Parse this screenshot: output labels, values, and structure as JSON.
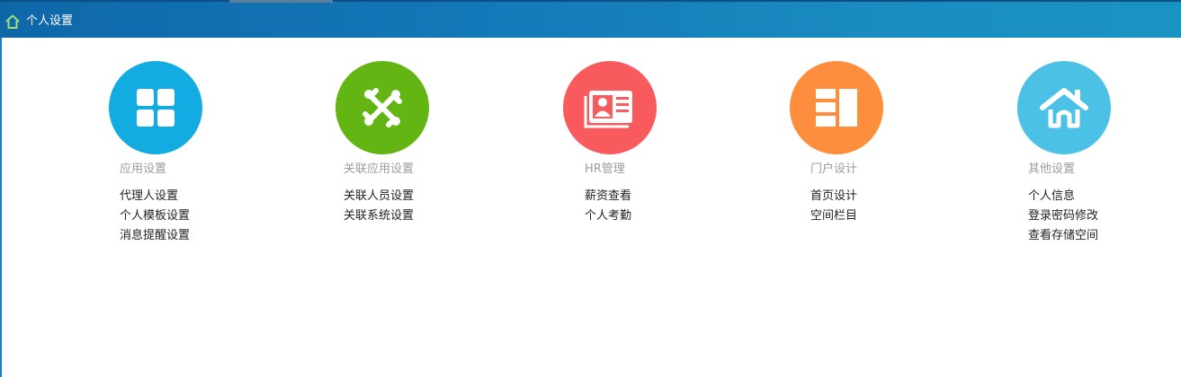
{
  "header": {
    "title": "个人设置",
    "home_icon": "home-icon",
    "bar_color": "#1378b7"
  },
  "sections": [
    {
      "icon": "grid-icon",
      "color": "#12ace3",
      "title": "应用设置",
      "links": [
        "代理人设置",
        "个人模板设置",
        "消息提醒设置"
      ]
    },
    {
      "icon": "joomla-icon",
      "color": "#62b512",
      "title": "关联应用设置",
      "links": [
        "关联人员设置",
        "关联系统设置"
      ]
    },
    {
      "icon": "id-card-icon",
      "color": "#f85a5e",
      "title": "HR管理",
      "links": [
        "薪资查看",
        "个人考勤"
      ]
    },
    {
      "icon": "layout-columns-icon",
      "color": "#fc8e3d",
      "title": "门户设计",
      "links": [
        "首页设计",
        "空间栏目"
      ]
    },
    {
      "icon": "house-icon",
      "color": "#4cc1e6",
      "title": "其他设置",
      "links": [
        "个人信息",
        "登录密码修改",
        "查看存储空间"
      ]
    }
  ]
}
